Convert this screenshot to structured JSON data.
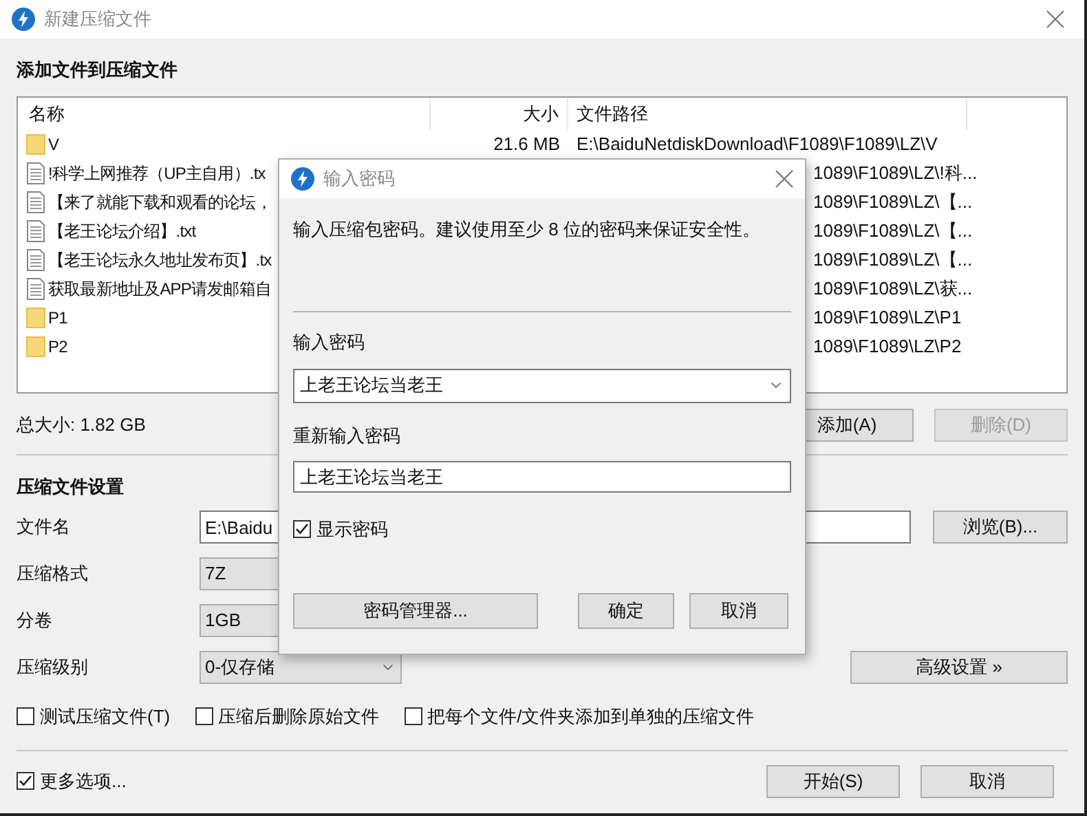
{
  "window": {
    "title": "新建压缩文件"
  },
  "files_section": {
    "heading": "添加文件到压缩文件",
    "columns": [
      "名称",
      "大小",
      "文件路径"
    ],
    "rows": [
      {
        "kind": "folder",
        "name": "V",
        "size": "21.6 MB",
        "path": "E:\\BaiduNetdiskDownload\\F1089\\F1089\\LZ\\V"
      },
      {
        "kind": "file",
        "name": "!科学上网推荐（UP主自用）.tx",
        "path": "1089\\F1089\\LZ\\!科..."
      },
      {
        "kind": "file",
        "name": "【来了就能下载和观看的论坛，",
        "path": "1089\\F1089\\LZ\\【..."
      },
      {
        "kind": "file",
        "name": "【老王论坛介绍】.txt",
        "path": "1089\\F1089\\LZ\\【..."
      },
      {
        "kind": "file",
        "name": "【老王论坛永久地址发布页】.tx",
        "path": "1089\\F1089\\LZ\\【..."
      },
      {
        "kind": "file",
        "name": "获取最新地址及APP请发邮箱自",
        "path": "1089\\F1089\\LZ\\获..."
      },
      {
        "kind": "folder",
        "name": "P1",
        "path": "1089\\F1089\\LZ\\P1"
      },
      {
        "kind": "folder",
        "name": "P2",
        "path": "1089\\F1089\\LZ\\P2"
      }
    ]
  },
  "total_size": "总大小: 1.82 GB",
  "list_buttons": [
    {
      "label": "添加(A)",
      "disabled": false
    },
    {
      "label": "删除(D)",
      "disabled": true
    }
  ],
  "settings": {
    "heading": "压缩文件设置",
    "fields": [
      {
        "kind": "input",
        "label": "文件名",
        "value": "E:\\Baidu",
        "button": "浏览(B)..."
      },
      {
        "kind": "dropdown",
        "label": "压缩格式",
        "value": "7Z"
      },
      {
        "kind": "dropdown",
        "label": "分卷",
        "value": "1GB"
      },
      {
        "kind": "dropdown",
        "label": "压缩级别",
        "value": "0-仅存储",
        "button": "高级设置 »"
      }
    ],
    "options": [
      {
        "label": "测试压缩文件(T)",
        "checked": false
      },
      {
        "label": "压缩后删除原始文件",
        "checked": false
      },
      {
        "label": "把每个文件/文件夹添加到单独的压缩文件",
        "checked": false
      }
    ]
  },
  "more_options": {
    "label": "更多选项...",
    "checked": true
  },
  "footer_buttons": [
    "开始(S)",
    "取消"
  ],
  "dialog": {
    "title": "输入密码",
    "description": "输入压缩包密码。建议使用至少 8 位的密码来保证安全性。",
    "password_label": "输入密码",
    "password": "上老王论坛当老王",
    "confirm_label": "重新输入密码",
    "confirm": "上老王论坛当老王",
    "show_password": {
      "label": "显示密码",
      "checked": true
    },
    "buttons": [
      "密码管理器...",
      "确定",
      "取消"
    ]
  }
}
